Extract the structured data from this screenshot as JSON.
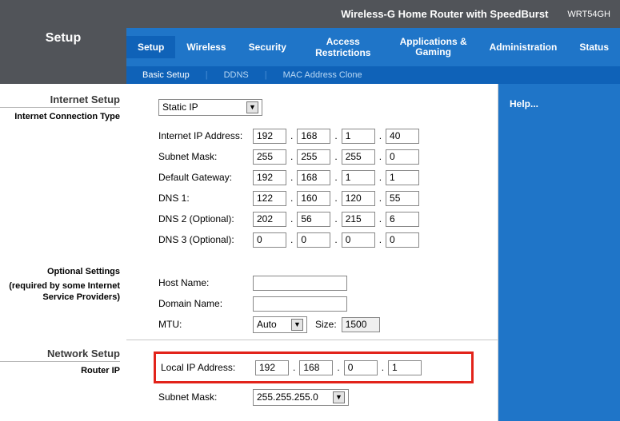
{
  "header": {
    "product": "Wireless-G Home Router with SpeedBurst",
    "model": "WRT54GH",
    "setup_label": "Setup"
  },
  "tabs": {
    "items": [
      {
        "label": "Setup",
        "active": true
      },
      {
        "label": "Wireless",
        "active": false
      },
      {
        "label": "Security",
        "active": false
      },
      {
        "label": "Access Restrictions",
        "active": false
      },
      {
        "label": "Applications &\nGaming",
        "active": false
      },
      {
        "label": "Administration",
        "active": false
      },
      {
        "label": "Status",
        "active": false
      }
    ],
    "sub": [
      {
        "label": "Basic Setup",
        "active": true
      },
      {
        "label": "DDNS",
        "active": false
      },
      {
        "label": "MAC Address Clone",
        "active": false
      }
    ]
  },
  "right": {
    "help": "Help..."
  },
  "left": {
    "internet_setup": "Internet Setup",
    "internet_conn_type": "Internet Connection Type",
    "optional_title": "Optional Settings",
    "optional_sub": "(required by some Internet Service Providers)",
    "network_setup": "Network Setup",
    "router_ip": "Router IP"
  },
  "form": {
    "conn_type": "Static IP",
    "labels": {
      "inet_ip": "Internet IP Address:",
      "subnet": "Subnet Mask:",
      "gateway": "Default Gateway:",
      "dns1": "DNS 1:",
      "dns2": "DNS 2 (Optional):",
      "dns3": "DNS 3 (Optional):",
      "host": "Host Name:",
      "domain": "Domain Name:",
      "mtu": "MTU:",
      "size": "Size:",
      "local_ip": "Local IP Address:",
      "subnet2": "Subnet Mask:"
    },
    "inet_ip": [
      "192",
      "168",
      "1",
      "40"
    ],
    "subnet": [
      "255",
      "255",
      "255",
      "0"
    ],
    "gateway": [
      "192",
      "168",
      "1",
      "1"
    ],
    "dns1": [
      "122",
      "160",
      "120",
      "55"
    ],
    "dns2": [
      "202",
      "56",
      "215",
      "6"
    ],
    "dns3": [
      "0",
      "0",
      "0",
      "0"
    ],
    "host_name": "",
    "domain_name": "",
    "mtu": "Auto",
    "mtu_size": "1500",
    "local_ip": [
      "192",
      "168",
      "0",
      "1"
    ],
    "subnet2": "255.255.255.0"
  }
}
